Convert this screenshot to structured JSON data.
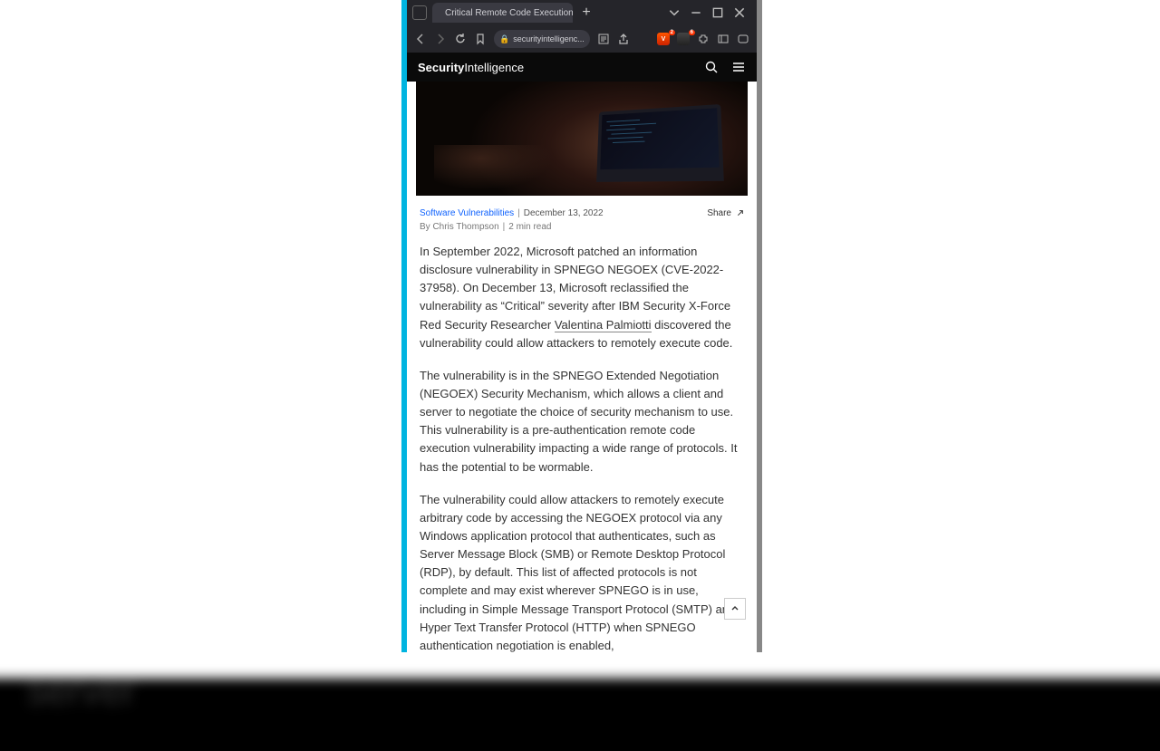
{
  "browser": {
    "tab_title": "Critical Remote Code Execution V",
    "url_display": "securityintelligenc...",
    "new_tab_glyph": "+"
  },
  "site": {
    "logo_bold": "Security",
    "logo_light": "Intelligence"
  },
  "meta": {
    "category": "Software Vulnerabilities",
    "date": "December 13, 2022",
    "share": "Share"
  },
  "byline": {
    "author": "By Chris Thompson",
    "read": "2 min read"
  },
  "article": {
    "p1a": "In September 2022, Microsoft patched an information disclosure vulnerability in SPNEGO NEGOEX (CVE-2022-37958). On December 13, Microsoft reclassified the vulnerability as “Critical” severity after IBM Security X-Force Red Security Researcher ",
    "p1_link": "Valentina Palmiotti",
    "p1b": " discovered the vulnerability could allow attackers to remotely execute code.",
    "p2": "The vulnerability is in the SPNEGO Extended Negotiation (NEGOEX) Security Mechanism, which allows a client and server to negotiate the choice of security mechanism to use. This vulnerability is a pre-authentication remote code execution vulnerability impacting a wide range of protocols. It has the potential to be wormable.",
    "p3": "The vulnerability could allow attackers to remotely execute arbitrary code by accessing the NEGOEX protocol via any Windows application protocol that authenticates, such as Server Message Block (SMB) or Remote Desktop Protocol (RDP), by default. This list of affected protocols is not complete and may exist wherever SPNEGO is in use, including in Simple Message Transport Protocol (SMTP) and Hyper Text Transfer Protocol (HTTP) when SPNEGO authentication negotiation is enabled,"
  },
  "bg": {
    "byline": "By Chris Thompson   |   2 min read",
    "p1": "In September 2022, Microsoft patched an information disclosure vulnerability in SPNEGO NEGOEX (CVE-2022-37958). On December 13, Microsoft reclassified the vulnerability as “Critical” severity after IBM Security X-Force Red Security Researcher Valentina Palmiotti discovered the vulnerability could allow attackers to remotely execute code.",
    "p2": "The vulnerability is in the SPNEGO Extended Negotiation (NEGOEX) Security Mechanism, which allows a client and server"
  }
}
